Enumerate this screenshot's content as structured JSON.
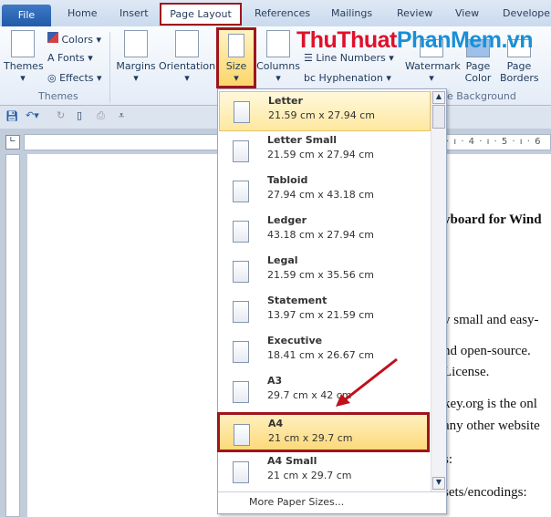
{
  "tabs": {
    "file": "File",
    "home": "Home",
    "insert": "Insert",
    "page_layout": "Page Layout",
    "references": "References",
    "mailings": "Mailings",
    "review": "Review",
    "view": "View",
    "developer": "Developer"
  },
  "ribbon": {
    "themes": "Themes",
    "colors": "Colors",
    "fonts": "Fonts",
    "effects": "Effects",
    "themes_group": "Themes",
    "margins": "Margins",
    "orientation": "Orientation",
    "size": "Size",
    "columns": "Columns",
    "line_numbers": "Line Numbers",
    "hyphenation": "Hyphenation",
    "watermark": "Watermark",
    "page_color": "Page Color",
    "page_borders": "Page Borders",
    "page_background_group": "e Background"
  },
  "watermark_logo": {
    "part1": "ThuThuat",
    "part2": "PhanMem",
    "part3": ".vn"
  },
  "ruler": {
    "labels": "· ı · 4 · ı · 5 · ı · 6"
  },
  "document": {
    "lines": [
      "yboard for Wind",
      "y small and easy-",
      "nd open-source.",
      "License.",
      "key.org is the onl",
      "any other website",
      "s:",
      "sets/encodings:"
    ]
  },
  "size_menu": {
    "items": [
      {
        "name": "Letter",
        "dims": "21.59 cm x 27.94 cm"
      },
      {
        "name": "Letter Small",
        "dims": "21.59 cm x 27.94 cm"
      },
      {
        "name": "Tabloid",
        "dims": "27.94 cm x 43.18 cm"
      },
      {
        "name": "Ledger",
        "dims": "43.18 cm x 27.94 cm"
      },
      {
        "name": "Legal",
        "dims": "21.59 cm x 35.56 cm"
      },
      {
        "name": "Statement",
        "dims": "13.97 cm x 21.59 cm"
      },
      {
        "name": "Executive",
        "dims": "18.41 cm x 26.67 cm"
      },
      {
        "name": "A3",
        "dims": "29.7 cm x 42 cm"
      },
      {
        "name": "A4",
        "dims": "21 cm x 29.7 cm"
      },
      {
        "name": "A4 Small",
        "dims": "21 cm x 29.7 cm"
      }
    ],
    "more": "More Paper Sizes..."
  },
  "colors": {
    "accent": "#a0141b",
    "logo_red": "#e0102a",
    "logo_blue": "#1a8fd6"
  }
}
